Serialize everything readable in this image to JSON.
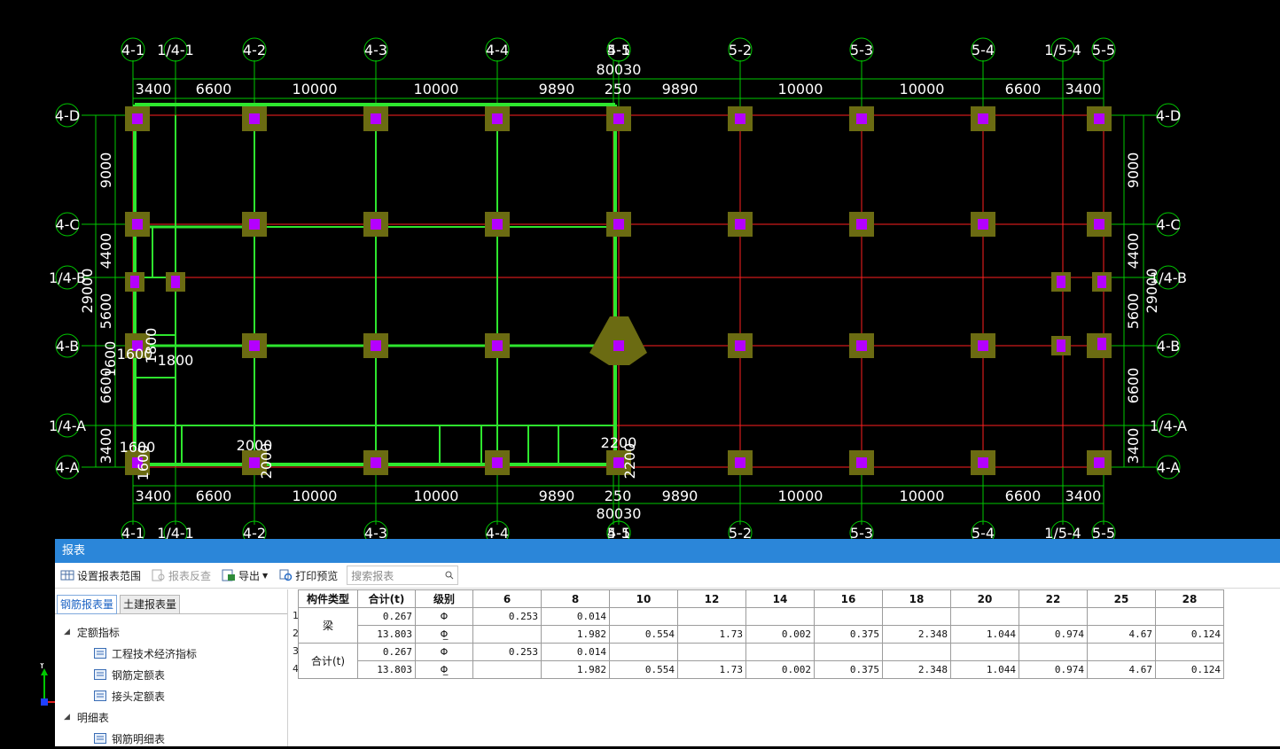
{
  "drawing": {
    "top_axis_labels": [
      "4-1",
      "1/4-1",
      "4-2",
      "4-3",
      "4-4",
      "4-5",
      "5-1",
      "5-2",
      "5-3",
      "5-4",
      "1/5-4",
      "5-5"
    ],
    "bottom_axis_labels": [
      "4-1",
      "1/4-1",
      "4-2",
      "4-3",
      "4-4",
      "4-5",
      "5-1",
      "5-2",
      "5-3",
      "5-4",
      "1/5-4",
      "5-5"
    ],
    "left_axis_labels": [
      "4-D",
      "4-C",
      "1/4-B",
      "4-B",
      "1/4-A",
      "4-A"
    ],
    "right_axis_labels": [
      "4-D",
      "4-C",
      "1/4-B",
      "4-B",
      "1/4-A",
      "4-A"
    ],
    "total_width_top": "80030",
    "total_width_bottom": "80030",
    "span_dims_top": [
      "3400",
      "6600",
      "10000",
      "10000",
      "9890",
      "250",
      "9890",
      "10000",
      "10000",
      "6600",
      "3400"
    ],
    "span_dims_bottom": [
      "3400",
      "6600",
      "10000",
      "10000",
      "9890",
      "250",
      "9890",
      "10000",
      "10000",
      "6600",
      "3400"
    ],
    "vert_dims_left": [
      "9000",
      "4400",
      "5600",
      "6600",
      "3400"
    ],
    "vert_dims_right": [
      "9000",
      "4400",
      "5600",
      "6600",
      "3400"
    ],
    "total_height_left": "29000",
    "total_height_right": "29000",
    "callouts": [
      "1600",
      "1600",
      "1800",
      "1800",
      "1600",
      "1600",
      "2000",
      "2000",
      "2200",
      "2200"
    ],
    "colors": {
      "axis": "#00c800",
      "grid_line": "#ff2020",
      "beam": "#2ee62e",
      "column": "#b400ff",
      "footing": "#6b6b12"
    }
  },
  "report": {
    "window_title": "报表",
    "toolbar": {
      "set_range": "设置报表范围",
      "reverse_check": "报表反查",
      "export": "导出",
      "print_preview": "打印预览",
      "search_placeholder": "搜索报表"
    },
    "tabs": [
      "钢筋报表量",
      "土建报表量"
    ],
    "tree": {
      "group1": "定额指标",
      "group1_items": [
        "工程技术经济指标",
        "钢筋定额表",
        "接头定额表"
      ],
      "group2": "明细表",
      "group2_items": [
        "钢筋明细表"
      ]
    },
    "table": {
      "headers": [
        "构件类型",
        "合计(t)",
        "级别",
        "6",
        "8",
        "10",
        "12",
        "14",
        "16",
        "18",
        "20",
        "22",
        "25",
        "28"
      ],
      "row_numbers": [
        "1",
        "2",
        "3",
        "4"
      ],
      "groups": [
        {
          "type": "梁",
          "rows": [
            {
              "total": "0.267",
              "grade": "Φ",
              "values": [
                "0.253",
                "0.014",
                "",
                "",
                "",
                "",
                "",
                "",
                "",
                "",
                ""
              ]
            },
            {
              "total": "13.803",
              "grade": "Φ̲",
              "values": [
                "",
                "1.982",
                "0.554",
                "1.73",
                "0.002",
                "0.375",
                "2.348",
                "1.044",
                "0.974",
                "4.67",
                "0.124"
              ]
            }
          ]
        },
        {
          "type": "合计(t)",
          "rows": [
            {
              "total": "0.267",
              "grade": "Φ",
              "values": [
                "0.253",
                "0.014",
                "",
                "",
                "",
                "",
                "",
                "",
                "",
                "",
                ""
              ]
            },
            {
              "total": "13.803",
              "grade": "Φ̲",
              "values": [
                "",
                "1.982",
                "0.554",
                "1.73",
                "0.002",
                "0.375",
                "2.348",
                "1.044",
                "0.974",
                "4.67",
                "0.124"
              ]
            }
          ]
        }
      ]
    }
  },
  "ucs": {
    "y_label": "Y"
  }
}
